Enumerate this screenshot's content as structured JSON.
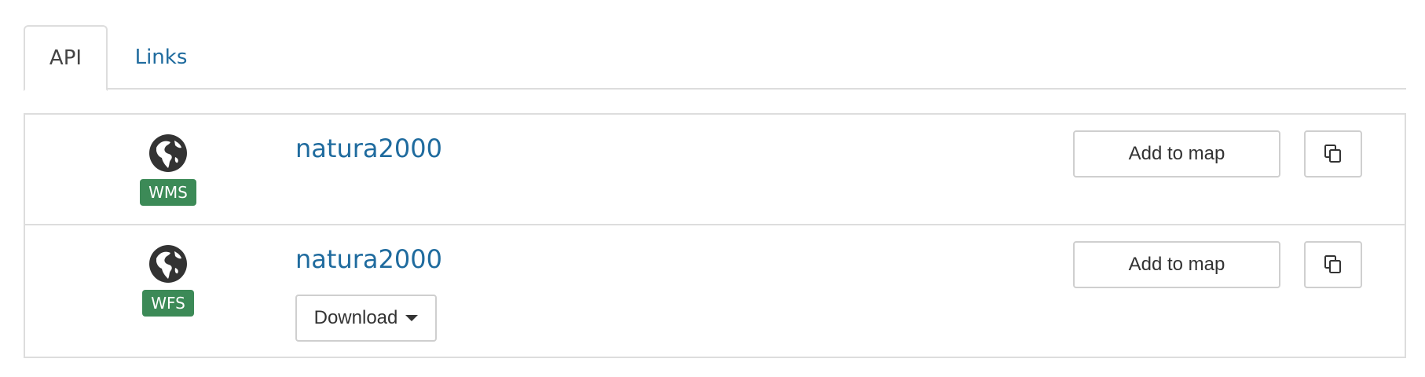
{
  "tabs": [
    {
      "label": "API",
      "active": true
    },
    {
      "label": "Links",
      "active": false
    }
  ],
  "resources": [
    {
      "service_badge": "WMS",
      "icon": "globe-icon",
      "title": "natura2000",
      "add_to_map_label": "Add to map",
      "copy_icon": "copy-icon"
    },
    {
      "service_badge": "WFS",
      "icon": "globe-icon",
      "title": "natura2000",
      "add_to_map_label": "Add to map",
      "copy_icon": "copy-icon",
      "download_label": "Download"
    }
  ],
  "colors": {
    "link": "#1f6b9e",
    "badge": "#3c8a57",
    "border": "#dddddd"
  }
}
